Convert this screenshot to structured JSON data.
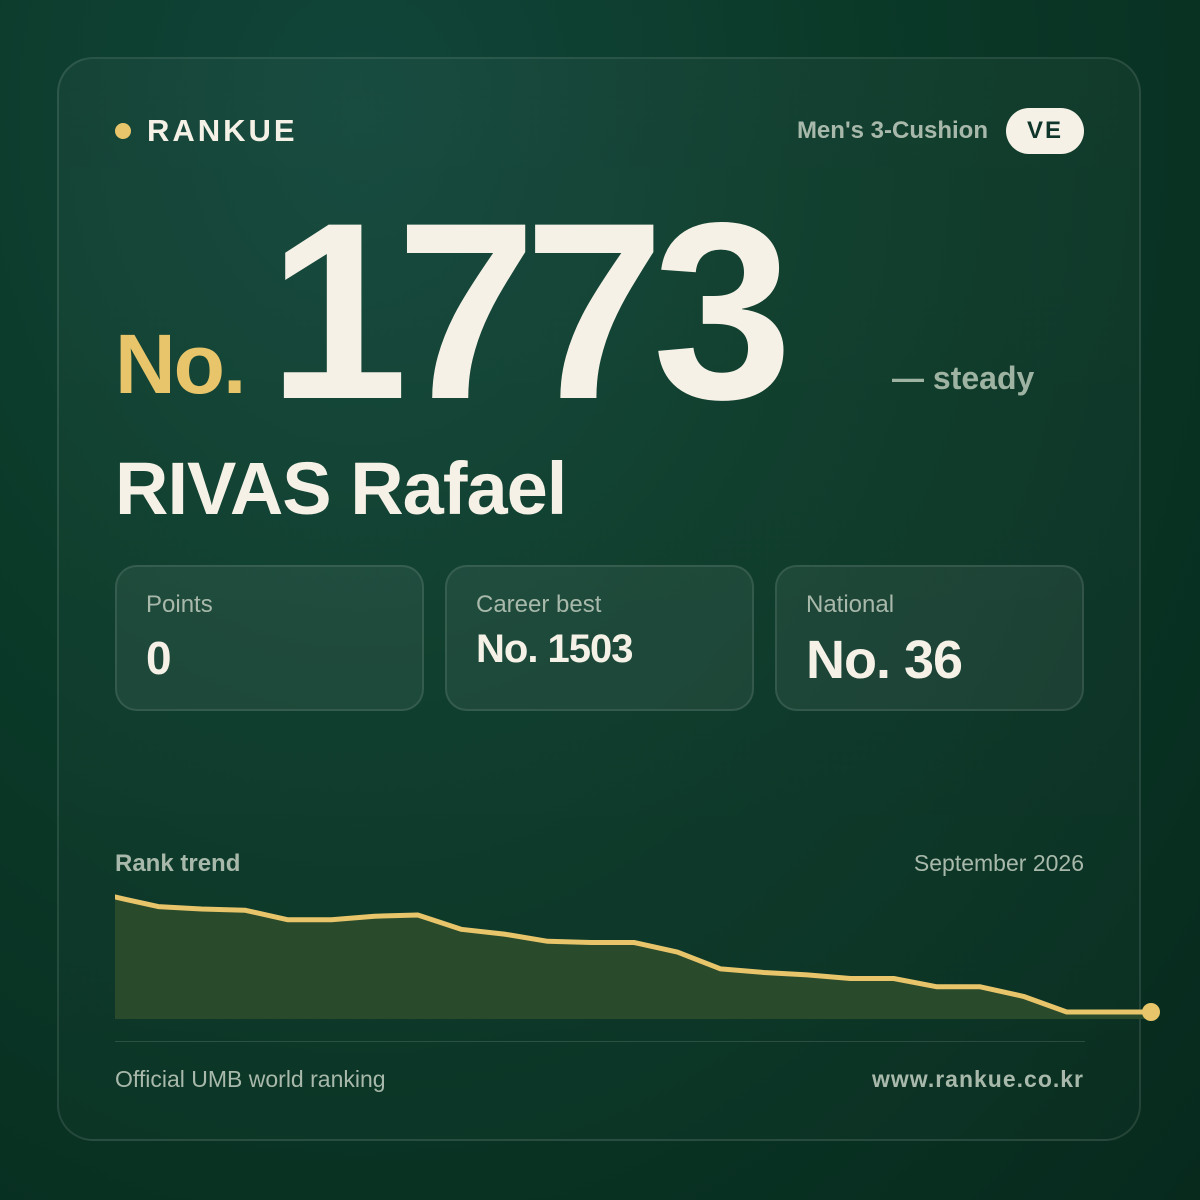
{
  "brand": {
    "name": "RANKUE",
    "dot_color": "#e8c56a"
  },
  "header": {
    "category": "Men's 3-Cushion",
    "country_code": "VE"
  },
  "rank": {
    "prefix": "No.",
    "number": "1773",
    "trend": "— steady"
  },
  "player": {
    "name": "RIVAS Rafael"
  },
  "stats": [
    {
      "label": "Points",
      "value": "0"
    },
    {
      "label": "Career best",
      "value": "No. 1503"
    },
    {
      "label": "National",
      "value": "No. 36"
    }
  ],
  "trend": {
    "title": "Rank trend",
    "date": "September 2026"
  },
  "chart_data": {
    "type": "area",
    "y_direction": "rank (lower line = worse rank)",
    "values": [
      0,
      8,
      10,
      11,
      19,
      19,
      16,
      15,
      27,
      31,
      37,
      38,
      38,
      46,
      60,
      63,
      65,
      68,
      68,
      75,
      75,
      83,
      96,
      96
    ],
    "line_color": "#e8c56a",
    "fill_color": "#2a4a2c"
  },
  "footer": {
    "source": "Official UMB world ranking",
    "url": "www.rankue.co.kr"
  }
}
